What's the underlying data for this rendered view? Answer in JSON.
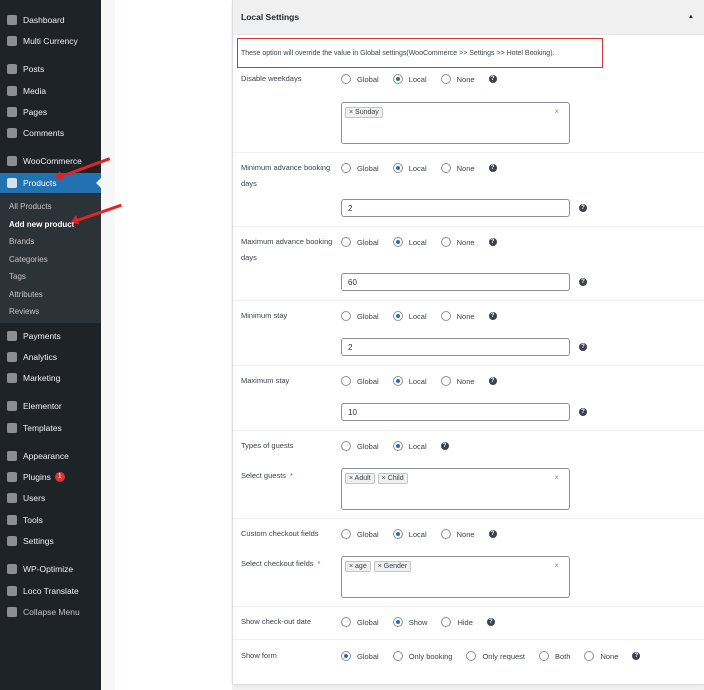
{
  "sidebar": {
    "top": [
      {
        "label": "Dashboard",
        "icon": "dashboard-icon"
      },
      {
        "label": "Multi Currency",
        "icon": "currency-icon"
      },
      {
        "label": "Posts",
        "icon": "pin-icon"
      },
      {
        "label": "Media",
        "icon": "media-icon"
      },
      {
        "label": "Pages",
        "icon": "pages-icon"
      },
      {
        "label": "Comments",
        "icon": "comment-icon"
      },
      {
        "label": "WooCommerce",
        "icon": "woocommerce-icon"
      },
      {
        "label": "Products",
        "icon": "products-icon"
      }
    ],
    "submenu": [
      "All Products",
      "Add new product",
      "Brands",
      "Categories",
      "Tags",
      "Attributes",
      "Reviews"
    ],
    "bottom": [
      {
        "label": "Payments",
        "icon": "payments-icon"
      },
      {
        "label": "Analytics",
        "icon": "analytics-icon"
      },
      {
        "label": "Marketing",
        "icon": "megaphone-icon"
      },
      {
        "label": "Elementor",
        "icon": "elementor-icon"
      },
      {
        "label": "Templates",
        "icon": "templates-icon"
      },
      {
        "label": "Appearance",
        "icon": "brush-icon"
      },
      {
        "label": "Plugins",
        "icon": "plugin-icon",
        "badge": "1"
      },
      {
        "label": "Users",
        "icon": "users-icon"
      },
      {
        "label": "Tools",
        "icon": "wrench-icon"
      },
      {
        "label": "Settings",
        "icon": "settings-icon"
      },
      {
        "label": "WP-Optimize",
        "icon": "optimize-icon"
      },
      {
        "label": "Loco Translate",
        "icon": "translate-icon"
      },
      {
        "label": "Collapse Menu",
        "icon": "collapse-icon"
      }
    ]
  },
  "panel": {
    "title": "Local Settings",
    "toggle": "▲",
    "notice": "These option will override the value in Global settings(WooCommerce >> Settings >> Hotel Booking).",
    "disable_weekdays": {
      "label": "Disable weekdays",
      "options": [
        "Global",
        "Local",
        "None"
      ],
      "tags": [
        "× Sunday"
      ]
    },
    "min_advance": {
      "label1": "Minimum advance booking",
      "label2": "days",
      "options": [
        "Global",
        "Local",
        "None"
      ],
      "value": "2"
    },
    "max_advance": {
      "label1": "Maximum advance booking",
      "label2": "days",
      "options": [
        "Global",
        "Local",
        "None"
      ],
      "value": "60"
    },
    "min_stay": {
      "label": "Minimum stay",
      "options": [
        "Global",
        "Local",
        "None"
      ],
      "value": "2"
    },
    "max_stay": {
      "label": "Maximum stay",
      "options": [
        "Global",
        "Local",
        "None"
      ],
      "value": "10"
    },
    "types_guests": {
      "label": "Types of guests",
      "options": [
        "Global",
        "Local"
      ]
    },
    "select_guests": {
      "label": "Select guests",
      "required": "*",
      "tags": [
        "× Adult",
        "× Child"
      ]
    },
    "custom_checkout": {
      "label": "Custom checkout fields",
      "options": [
        "Global",
        "Local",
        "None"
      ]
    },
    "select_checkout": {
      "label": "Select checkout fields",
      "required": "*",
      "tags": [
        "× age",
        "× Gender"
      ]
    },
    "checkout_date": {
      "label": "Show check-out date",
      "options": [
        "Global",
        "Show",
        "Hide"
      ]
    },
    "show_form": {
      "label": "Show form",
      "options": [
        "Global",
        "Only booking",
        "Only request",
        "Both",
        "None"
      ]
    },
    "help": "?",
    "clear": "×"
  }
}
